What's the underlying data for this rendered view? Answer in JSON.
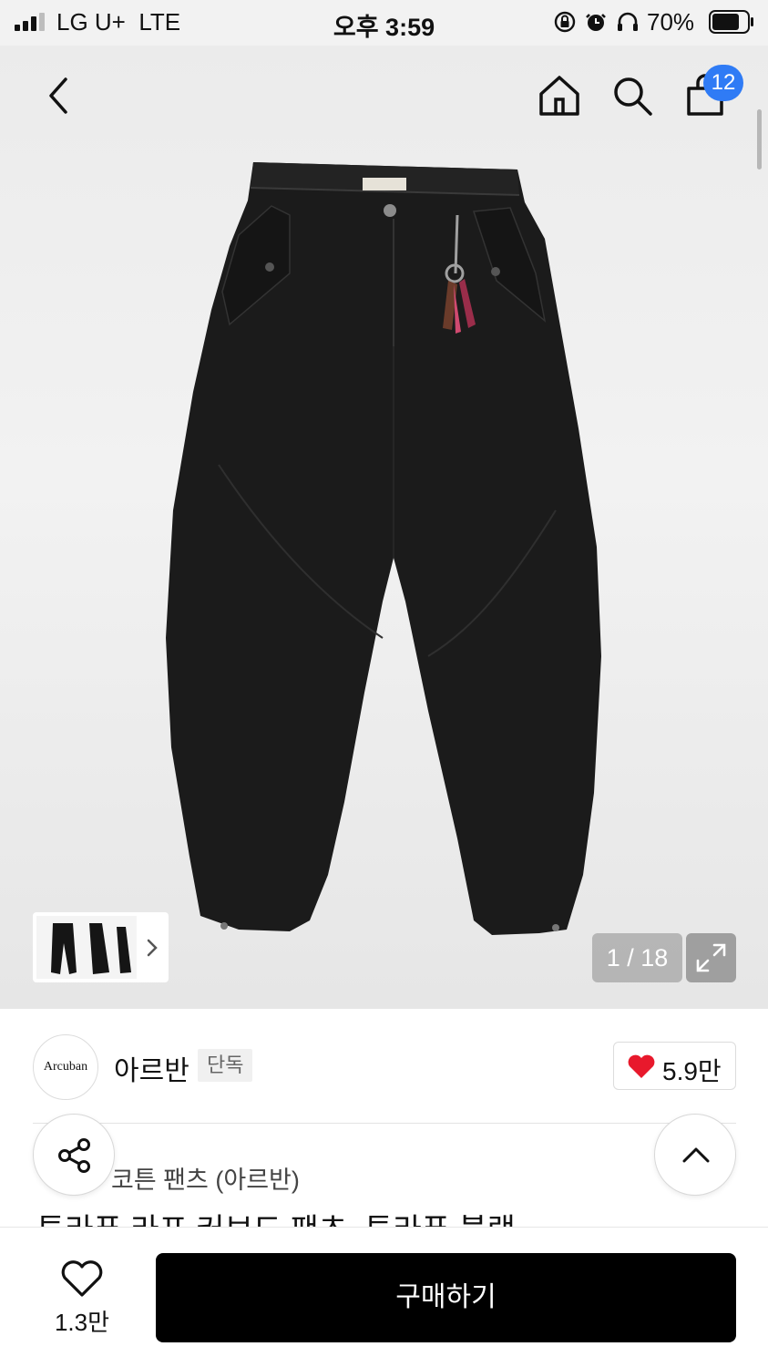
{
  "status_bar": {
    "carrier": "LG U+  LTE",
    "time": "오후 3:59",
    "battery": "70%"
  },
  "header": {
    "cart_count": "12",
    "icons": [
      "back-icon",
      "home-icon",
      "search-icon",
      "cart-icon"
    ]
  },
  "gallery": {
    "counter": "1 / 18",
    "expand_icon": "expand-icon"
  },
  "brand": {
    "logo_text": "Arcuban",
    "name": "아르반",
    "tag": "단독",
    "like_count": "5.9만"
  },
  "product": {
    "category": "코튼 팬츠 (아르반)",
    "title": "투라푸 라프 커브드 팬츠_투라푸 블랙"
  },
  "bottom_bar": {
    "wish_count": "1.3만",
    "buy_label": "구매하기"
  },
  "colors": {
    "accent_badge": "#2f7bf5",
    "heart": "#e8192c",
    "buy_button": "#000000"
  }
}
